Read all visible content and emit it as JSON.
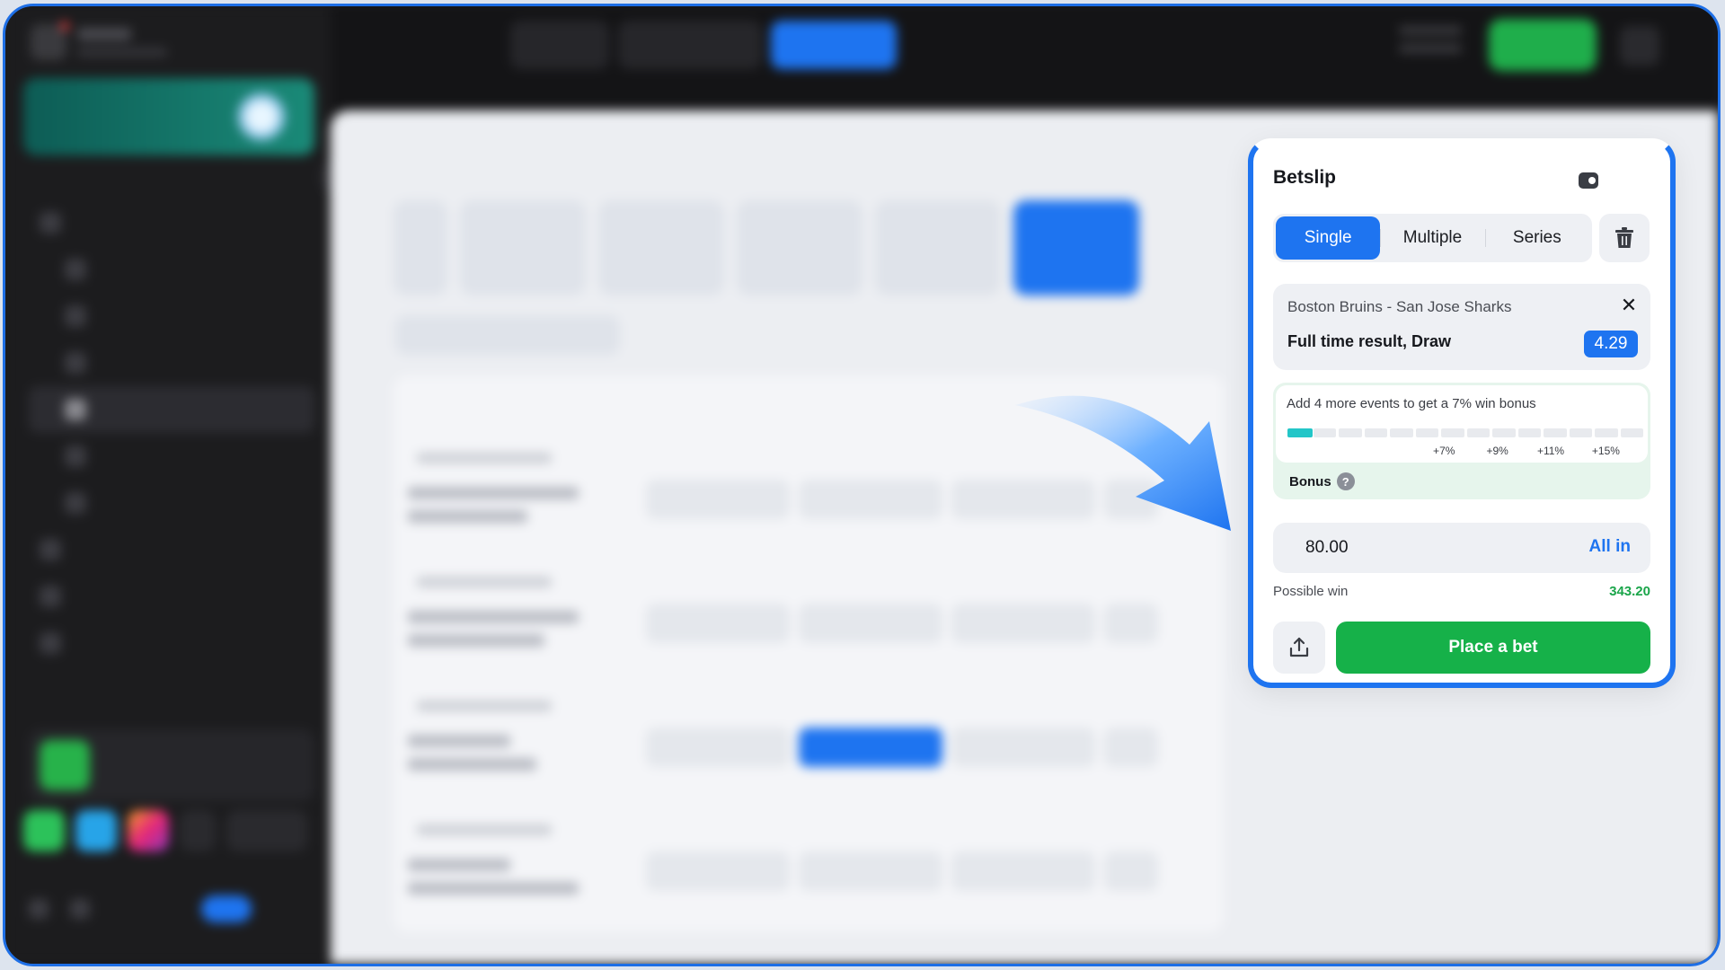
{
  "betslip": {
    "title": "Betslip",
    "tabs": [
      {
        "label": "Single",
        "active": true
      },
      {
        "label": "Multiple",
        "active": false
      },
      {
        "label": "Series",
        "active": false
      }
    ],
    "event": {
      "match": "Boston Bruins - San Jose Sharks",
      "market": "Full time result, Draw",
      "coefficient": "4.29"
    },
    "bonus": {
      "message": "Add 4 more events to get a 7% win bonus",
      "progress_fraction": 0.07,
      "steps": [
        "+7%",
        "+9%",
        "+11%",
        "+15%"
      ],
      "label": "Bonus",
      "help": "?"
    },
    "stake": {
      "value": "80.00",
      "all_in_label": "All in"
    },
    "possible_win": {
      "label": "Possible win",
      "value": "343.20"
    },
    "place_bet_label": "Place a bet"
  },
  "colors": {
    "accent": "#1e74f0",
    "success": "#16b149",
    "progress": "#23c6c8",
    "win_text": "#1aa54a"
  },
  "icons": {
    "trash": "trash-icon",
    "close": "close-icon",
    "share": "share-icon",
    "help": "help-icon",
    "toggle": "toggle-icon"
  }
}
